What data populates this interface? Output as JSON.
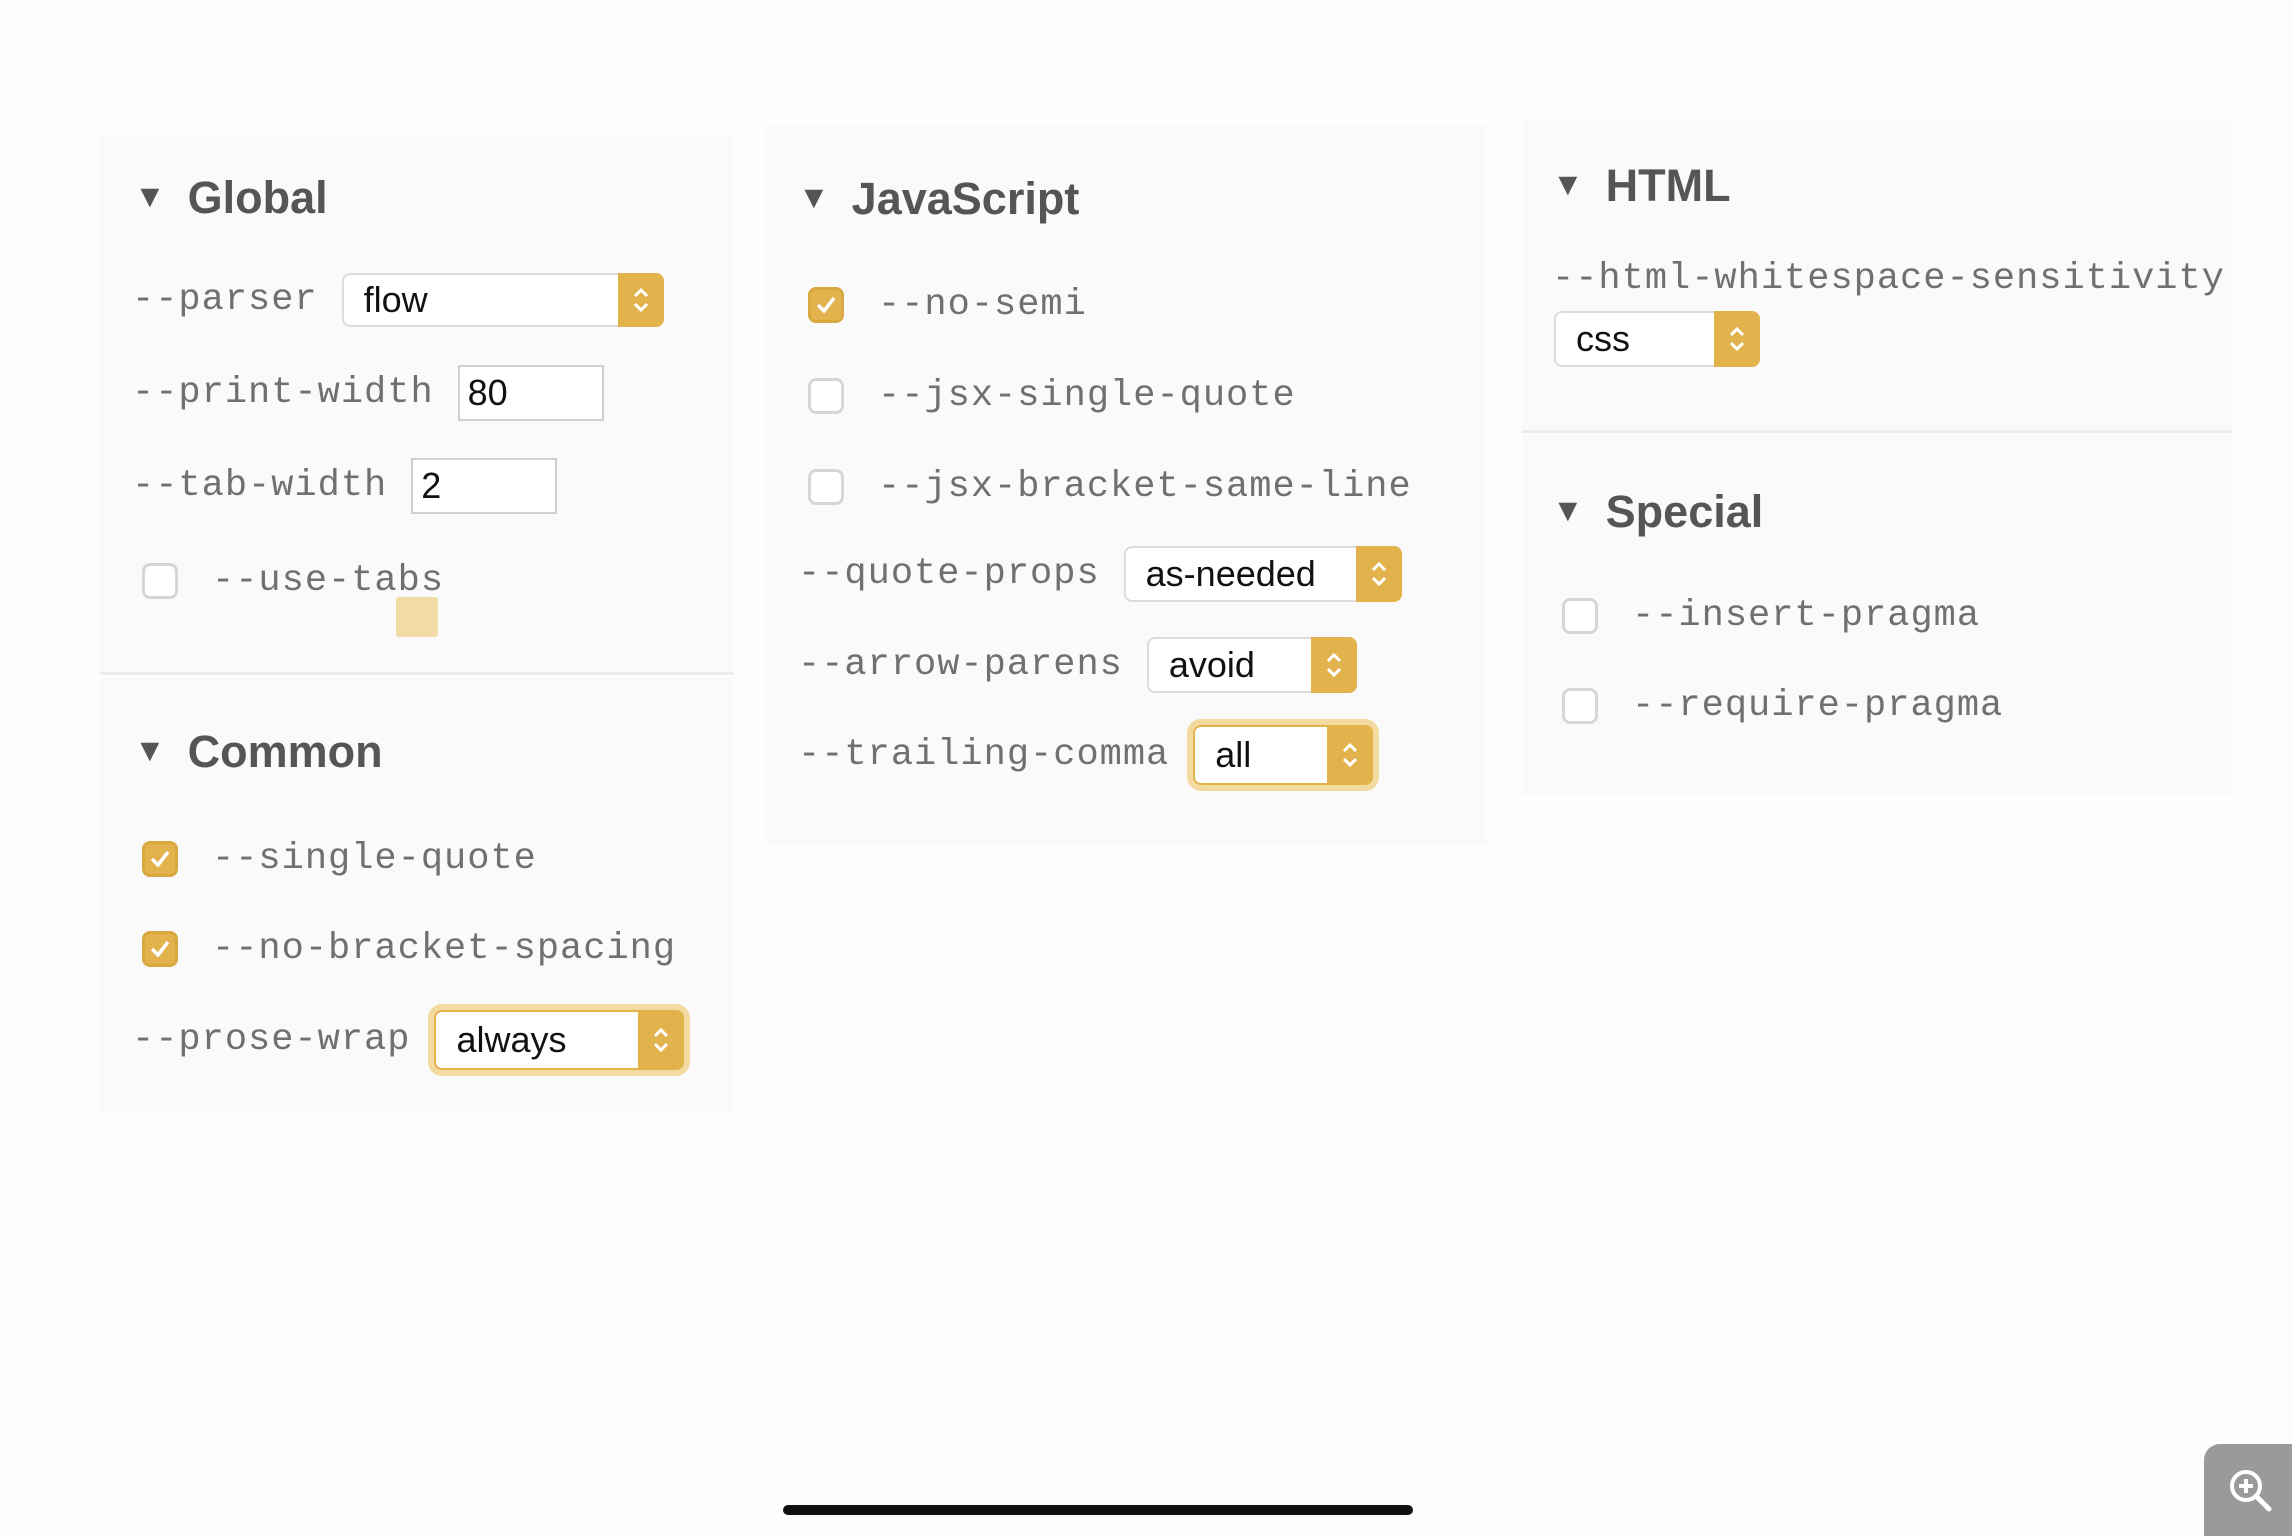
{
  "global": {
    "title": "Global",
    "parser": {
      "label": "--parser",
      "value": "flow"
    },
    "print_width": {
      "label": "--print-width",
      "value": "80"
    },
    "tab_width": {
      "label": "--tab-width",
      "value": "2"
    },
    "use_tabs": {
      "label": "--use-tabs",
      "checked": false
    }
  },
  "common": {
    "title": "Common",
    "single_quote": {
      "label": "--single-quote",
      "checked": true
    },
    "no_bracket_spacing": {
      "label": "--no-bracket-spacing",
      "checked": true
    },
    "prose_wrap": {
      "label": "--prose-wrap",
      "value": "always"
    }
  },
  "javascript": {
    "title": "JavaScript",
    "no_semi": {
      "label": "--no-semi",
      "checked": true
    },
    "jsx_single_quote": {
      "label": "--jsx-single-quote",
      "checked": false
    },
    "jsx_bracket_same_line": {
      "label": "--jsx-bracket-same-line",
      "checked": false
    },
    "quote_props": {
      "label": "--quote-props",
      "value": "as-needed"
    },
    "arrow_parens": {
      "label": "--arrow-parens",
      "value": "avoid"
    },
    "trailing_comma": {
      "label": "--trailing-comma",
      "value": "all"
    }
  },
  "html": {
    "title": "HTML",
    "whitespace_sensitivity": {
      "label": "--html-whitespace-sensitivity",
      "value": "css"
    }
  },
  "special": {
    "title": "Special",
    "insert_pragma": {
      "label": "--insert-pragma",
      "checked": false
    },
    "require_pragma": {
      "label": "--require-pragma",
      "checked": false
    }
  },
  "colors": {
    "accent": "#e2b34c",
    "label": "#707070",
    "heading": "#555555"
  },
  "icons": {
    "expand": "triangle-down-icon",
    "checkbox": "checkmark-icon",
    "select": "stepper-icon",
    "zoom": "zoom-in-icon"
  }
}
